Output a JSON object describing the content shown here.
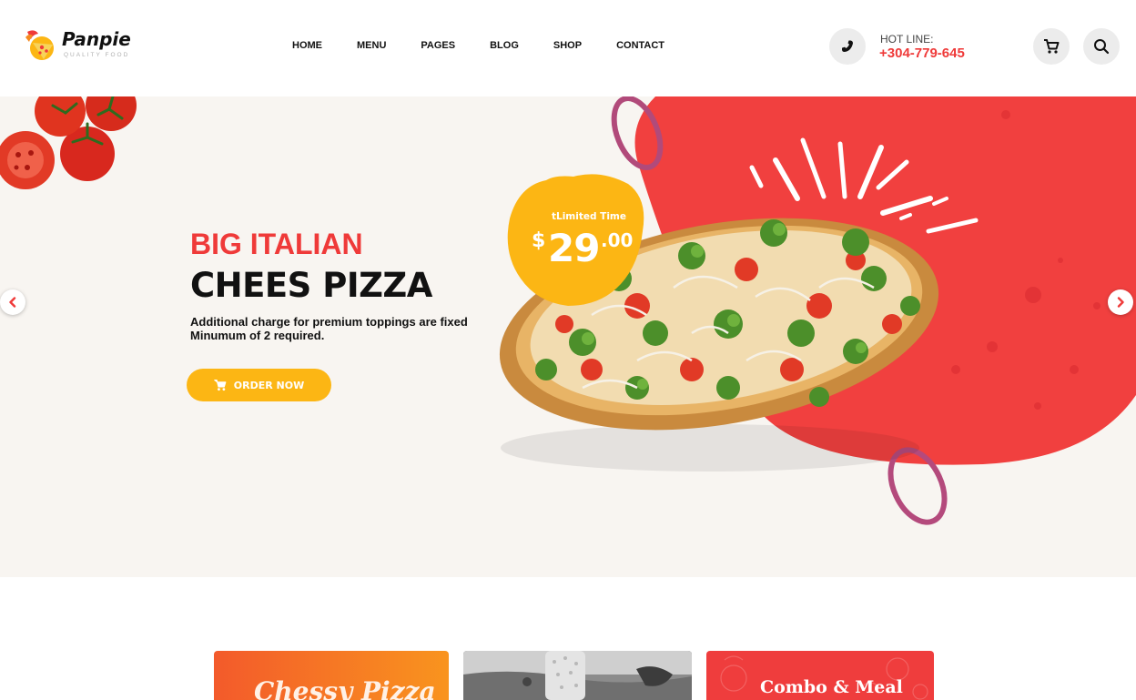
{
  "brand": {
    "name": "Panpie",
    "tagline": "QUALITY FOOD"
  },
  "nav": {
    "items": [
      {
        "label": "HOME"
      },
      {
        "label": "MENU"
      },
      {
        "label": "PAGES"
      },
      {
        "label": "BLOG"
      },
      {
        "label": "SHOP"
      },
      {
        "label": "CONTACT"
      }
    ]
  },
  "hotline": {
    "label": "HOT LINE:",
    "number": "+304-779-645"
  },
  "hero": {
    "subtitle": "BIG ITALIAN",
    "title": "CHEES PIZZA",
    "description": "Additional charge for premium toppings are fixed Minumum of 2 required.",
    "order_label": "ORDER NOW",
    "badge": {
      "label": "tLimited Time",
      "currency": "$",
      "price_int": "29",
      "price_dec": ".00"
    }
  },
  "categories": [
    {
      "label": "Chessy Pizza"
    },
    {
      "label": ""
    },
    {
      "label": "Combo & Meal"
    }
  ],
  "colors": {
    "accent_red": "#ef3a39",
    "accent_yellow": "#fcb614",
    "hero_bg": "#f8f5f1",
    "text_dark": "#111111"
  },
  "icons": {
    "phone": "phone-icon",
    "cart": "cart-icon",
    "search": "search-icon",
    "prev": "chevron-left-icon",
    "next": "chevron-right-icon"
  }
}
